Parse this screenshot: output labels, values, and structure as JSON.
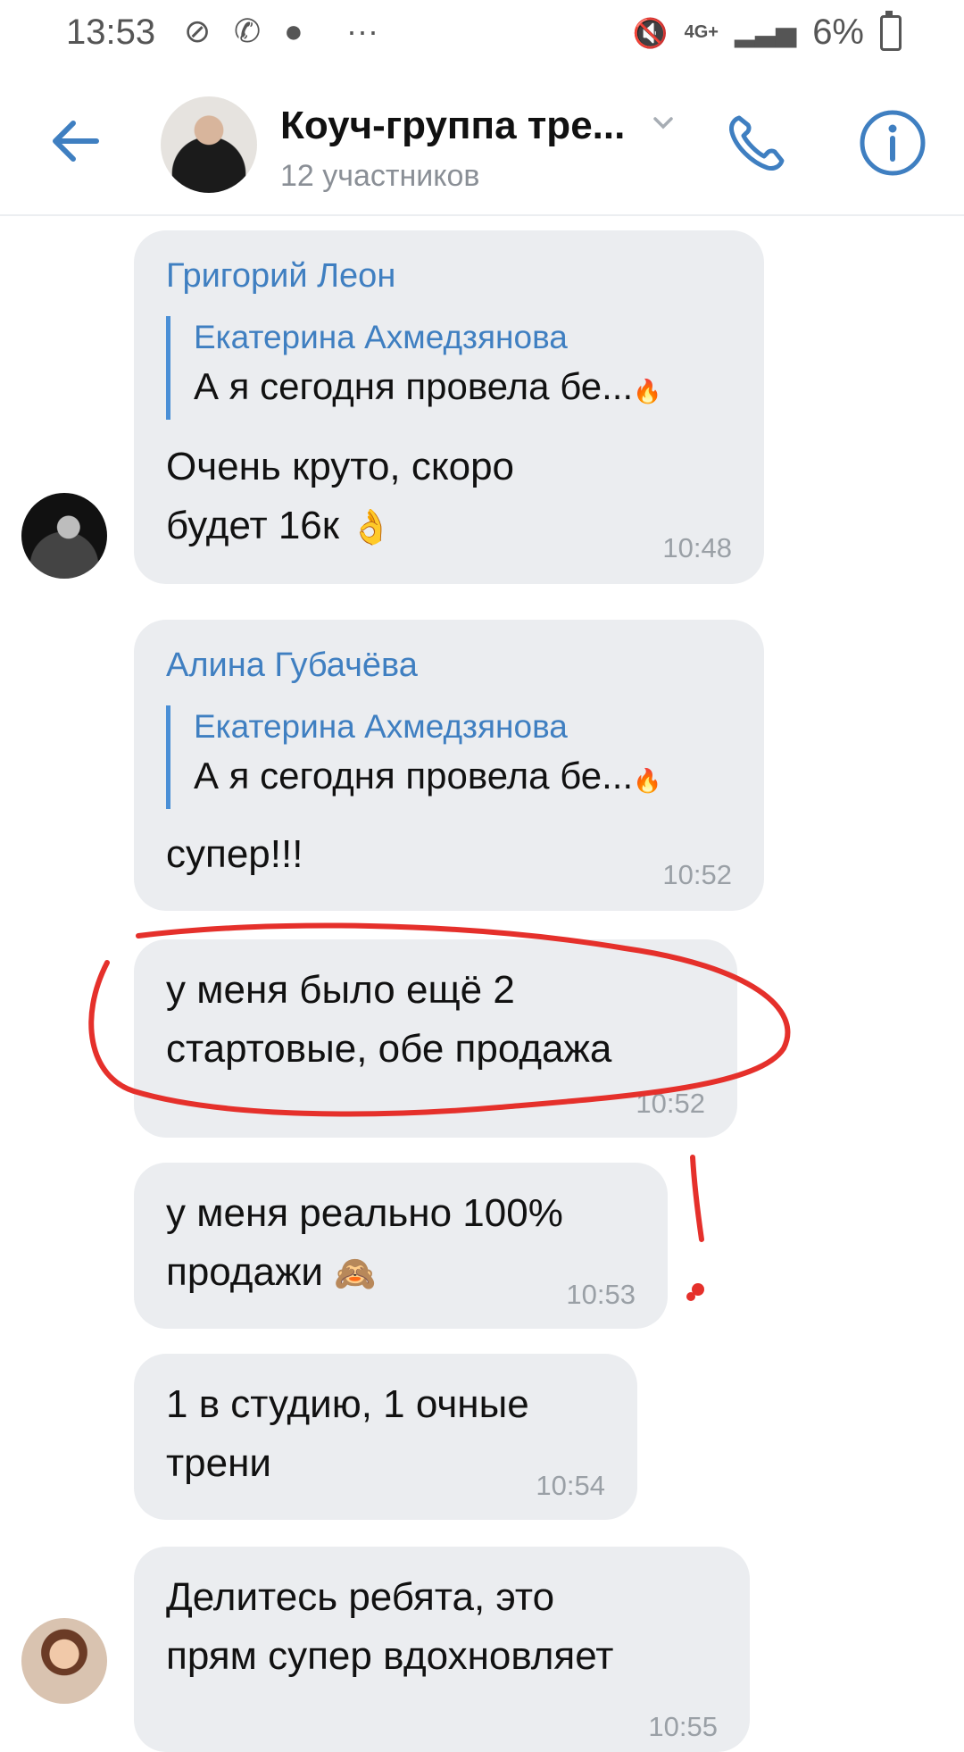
{
  "status_bar": {
    "time": "13:53",
    "network": "4G+",
    "battery": "6%"
  },
  "header": {
    "title": "Коуч-группа тре...",
    "subtitle": "12 участников",
    "accent_color": "#3f7fc1"
  },
  "messages": [
    {
      "sender": "Григорий Леон",
      "reply_author": "Екатерина Ахмедзянова",
      "reply_text": "А я сегодня провела бе...",
      "text": "Очень круто,  скоро\nбудет 16к",
      "emoji": "👌",
      "time": "10:48"
    },
    {
      "sender": "Алина Губачёва",
      "reply_author": "Екатерина Ахмедзянова",
      "reply_text": "А я сегодня провела бе...",
      "text": "супер!!!",
      "time": "10:52"
    },
    {
      "text": "у меня было ещё 2\nстартовые, обе продажа",
      "time": "10:52"
    },
    {
      "text": "у меня реально 100%\nпродажи",
      "emoji": "🙈",
      "time": "10:53"
    },
    {
      "text": "1 в студию, 1 очные\nтрени",
      "time": "10:54"
    },
    {
      "text": "Делитесь ребята,  это\nпрям супер вдохновляет",
      "time": "10:55"
    }
  ]
}
